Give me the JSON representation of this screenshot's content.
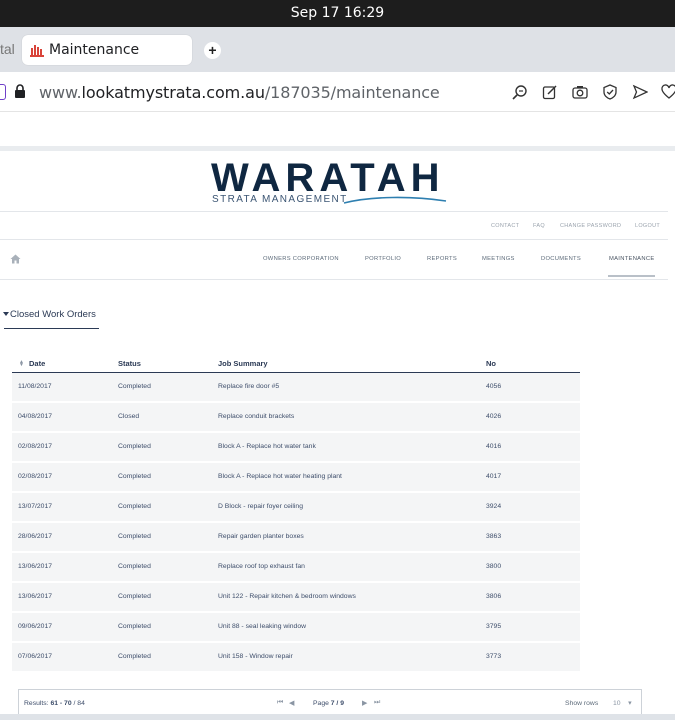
{
  "os": {
    "clock": "Sep 17  16:29"
  },
  "browser": {
    "prev_tab_fragment": "tal",
    "active_tab_title": "Maintenance",
    "new_tab_symbol": "+",
    "url_prefix": "www.",
    "url_domain": "lookatmystrata.com.au",
    "url_path": "/187035/maintenance"
  },
  "header": {
    "logo_word": "WARATAH",
    "logo_sub": "STRATA MANAGEMENT",
    "util_nav": [
      "CONTACT",
      "FAQ",
      "CHANGE PASSWORD",
      "LOGOUT"
    ],
    "main_nav": [
      "OWNERS CORPORATION",
      "PORTFOLIO",
      "REPORTS",
      "MEETINGS",
      "DOCUMENTS",
      "MAINTENANCE"
    ]
  },
  "section": {
    "title": "Closed Work Orders"
  },
  "table": {
    "columns": [
      "Date",
      "Status",
      "Job Summary",
      "No"
    ],
    "rows": [
      [
        "11/08/2017",
        "Completed",
        "Replace fire door #5",
        "4056"
      ],
      [
        "04/08/2017",
        "Closed",
        "Replace conduit brackets",
        "4026"
      ],
      [
        "02/08/2017",
        "Completed",
        "Block A - Replace hot water tank",
        "4016"
      ],
      [
        "02/08/2017",
        "Completed",
        "Block A - Replace hot water heating plant",
        "4017"
      ],
      [
        "13/07/2017",
        "Completed",
        "D Block - repair foyer ceiling",
        "3924"
      ],
      [
        "28/06/2017",
        "Completed",
        "Repair garden planter boxes",
        "3863"
      ],
      [
        "13/06/2017",
        "Completed",
        "Replace roof top exhaust fan",
        "3800"
      ],
      [
        "13/06/2017",
        "Completed",
        "Unit 122 - Repair kitchen & bedroom windows",
        "3806"
      ],
      [
        "09/06/2017",
        "Completed",
        "Unit 88 - seal leaking window",
        "3795"
      ],
      [
        "07/06/2017",
        "Completed",
        "Unit 158 - Window repair",
        "3773"
      ]
    ]
  },
  "pager": {
    "results_label": "Results:",
    "results_range": "61 - 70",
    "results_total": "/ 84",
    "page_label": "Page",
    "page_current": "7 / 9",
    "show_rows_label": "Show rows",
    "rows_value": "10"
  }
}
